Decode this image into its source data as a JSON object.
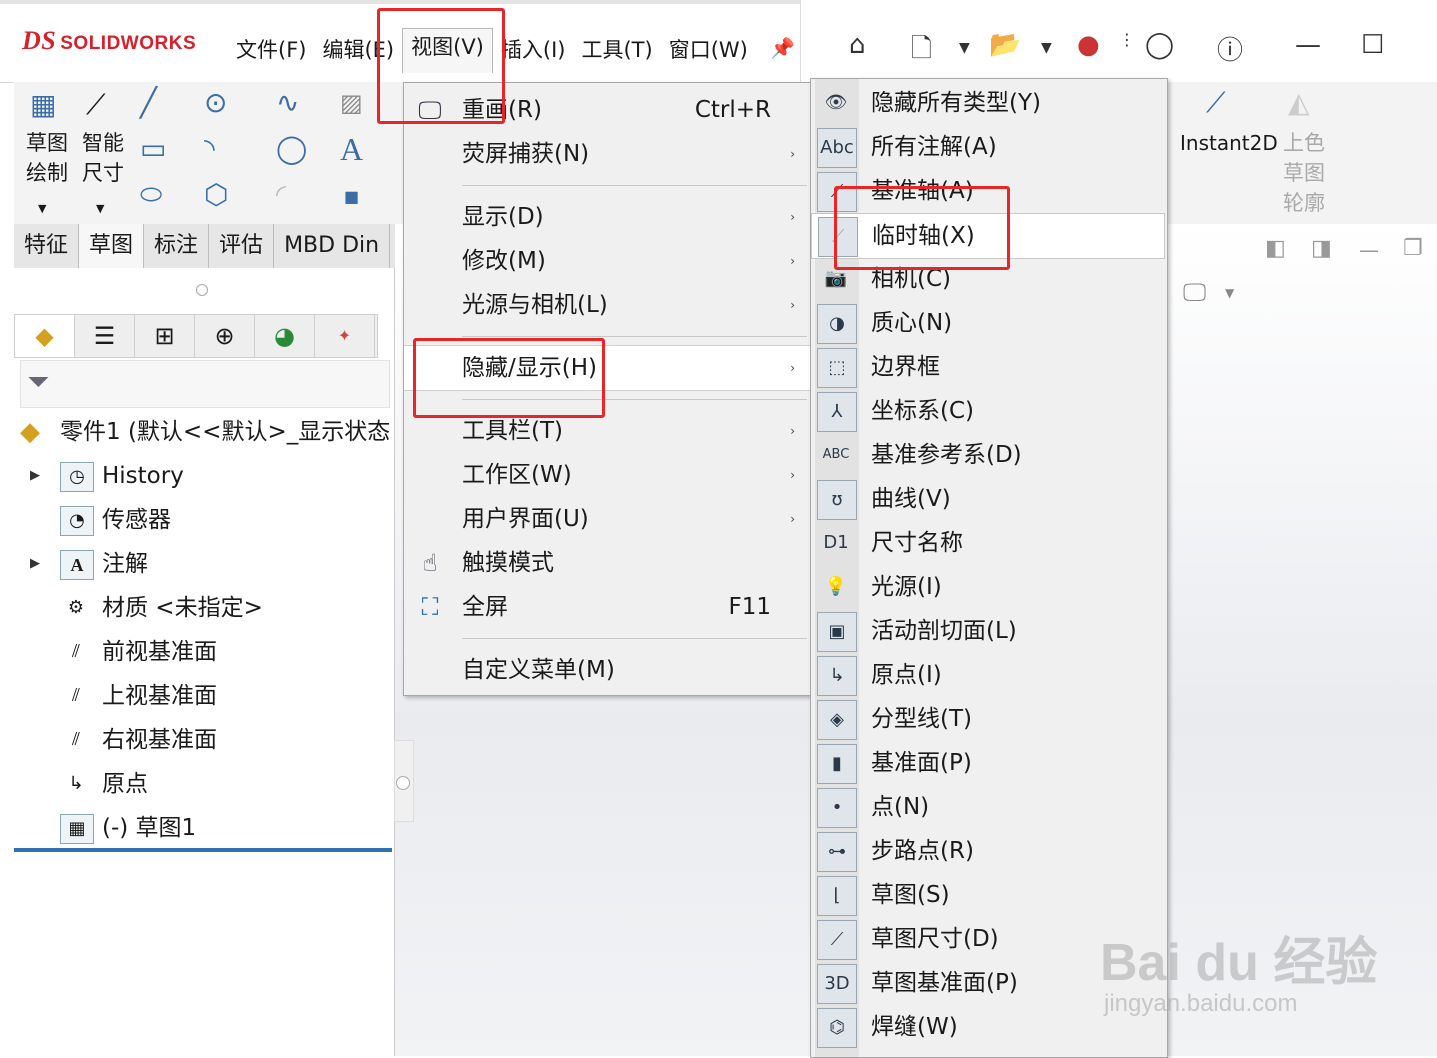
{
  "app": {
    "logo_text": "SOLIDWORKS",
    "logo_mark": "DS"
  },
  "menubar": {
    "items": [
      "文件(F)",
      "编辑(E)",
      "视图(V)",
      "插入(I)",
      "工具(T)",
      "窗口(W)"
    ],
    "pin_icon": "pin-icon"
  },
  "ribbon": {
    "sketch_label": "草图\n绘制",
    "smart_dim_label": "智能\n尺寸",
    "instant2d_label": "Instant2D",
    "shaded_sketch_label": "上色\n草图\n轮廓"
  },
  "tabs": [
    "特征",
    "草图",
    "标注",
    "评估",
    "MBD Din"
  ],
  "tree": {
    "part_label": "零件1 (默认<<默认>_显示状态",
    "items": [
      {
        "label": "History",
        "icon": "history-icon",
        "expand": true
      },
      {
        "label": "传感器",
        "icon": "sensor-icon",
        "expand": false
      },
      {
        "label": "注解",
        "icon": "annotation-icon",
        "expand": true
      },
      {
        "label": "材质 <未指定>",
        "icon": "material-icon",
        "expand": false
      },
      {
        "label": "前视基准面",
        "icon": "plane-icon",
        "expand": false
      },
      {
        "label": "上视基准面",
        "icon": "plane-icon",
        "expand": false
      },
      {
        "label": "右视基准面",
        "icon": "plane-icon",
        "expand": false
      },
      {
        "label": "原点",
        "icon": "origin-icon",
        "expand": false
      },
      {
        "label": "(-) 草图1",
        "icon": "sketch-icon",
        "expand": false
      }
    ]
  },
  "view_menu": {
    "items": [
      {
        "label": "重画(R)",
        "shortcut": "Ctrl+R",
        "submenu": false,
        "icon": "redraw-icon"
      },
      {
        "label": "荧屏捕获(N)",
        "shortcut": "",
        "submenu": true,
        "icon": ""
      },
      {
        "label": "显示(D)",
        "shortcut": "",
        "submenu": true,
        "icon": ""
      },
      {
        "label": "修改(M)",
        "shortcut": "",
        "submenu": true,
        "icon": ""
      },
      {
        "label": "光源与相机(L)",
        "shortcut": "",
        "submenu": true,
        "icon": ""
      },
      {
        "label": "隐藏/显示(H)",
        "shortcut": "",
        "submenu": true,
        "icon": ""
      },
      {
        "label": "工具栏(T)",
        "shortcut": "",
        "submenu": true,
        "icon": ""
      },
      {
        "label": "工作区(W)",
        "shortcut": "",
        "submenu": true,
        "icon": ""
      },
      {
        "label": "用户界面(U)",
        "shortcut": "",
        "submenu": true,
        "icon": ""
      },
      {
        "label": "触摸模式",
        "shortcut": "",
        "submenu": false,
        "icon": "touch-icon"
      },
      {
        "label": "全屏",
        "shortcut": "F11",
        "submenu": false,
        "icon": "fullscreen-icon"
      },
      {
        "label": "自定义菜单(M)",
        "shortcut": "",
        "submenu": false,
        "icon": ""
      }
    ]
  },
  "hide_show_submenu": {
    "items": [
      {
        "label": "隐藏所有类型(Y)",
        "icon": "eye-icon"
      },
      {
        "label": "所有注解(A)",
        "icon": "abc-annotation-icon"
      },
      {
        "label": "基准轴(A)",
        "icon": "axis-icon"
      },
      {
        "label": "临时轴(X)",
        "icon": "temporary-axis-icon"
      },
      {
        "label": "相机(C)",
        "icon": "camera-icon"
      },
      {
        "label": "质心(N)",
        "icon": "center-of-mass-icon"
      },
      {
        "label": "边界框",
        "icon": "bounding-box-icon"
      },
      {
        "label": "坐标系(C)",
        "icon": "coordinate-system-icon"
      },
      {
        "label": "基准参考系(D)",
        "icon": "datum-reference-icon"
      },
      {
        "label": "曲线(V)",
        "icon": "curve-icon"
      },
      {
        "label": "尺寸名称",
        "icon": "dimension-name-icon"
      },
      {
        "label": "光源(I)",
        "icon": "light-icon"
      },
      {
        "label": "活动剖切面(L)",
        "icon": "section-plane-icon"
      },
      {
        "label": "原点(I)",
        "icon": "origin-icon"
      },
      {
        "label": "分型线(T)",
        "icon": "parting-line-icon"
      },
      {
        "label": "基准面(P)",
        "icon": "plane-icon"
      },
      {
        "label": "点(N)",
        "icon": "point-icon"
      },
      {
        "label": "步路点(R)",
        "icon": "route-point-icon"
      },
      {
        "label": "草图(S)",
        "icon": "sketch-icon"
      },
      {
        "label": "草图尺寸(D)",
        "icon": "sketch-dimension-icon"
      },
      {
        "label": "草图基准面(P)",
        "icon": "sketch-plane-3d-icon"
      },
      {
        "label": "焊缝(W)",
        "icon": "weld-icon"
      }
    ],
    "d1_glyph": "D1",
    "abc_glyph": "Abc",
    "d3_glyph": "3D"
  },
  "watermark": {
    "main": "Bai du 经验",
    "sub": "jingyan.baidu.com"
  },
  "colors": {
    "highlight_red": "#e8262a",
    "brand_red": "#d6202c",
    "accent_blue": "#2f6fb3"
  }
}
